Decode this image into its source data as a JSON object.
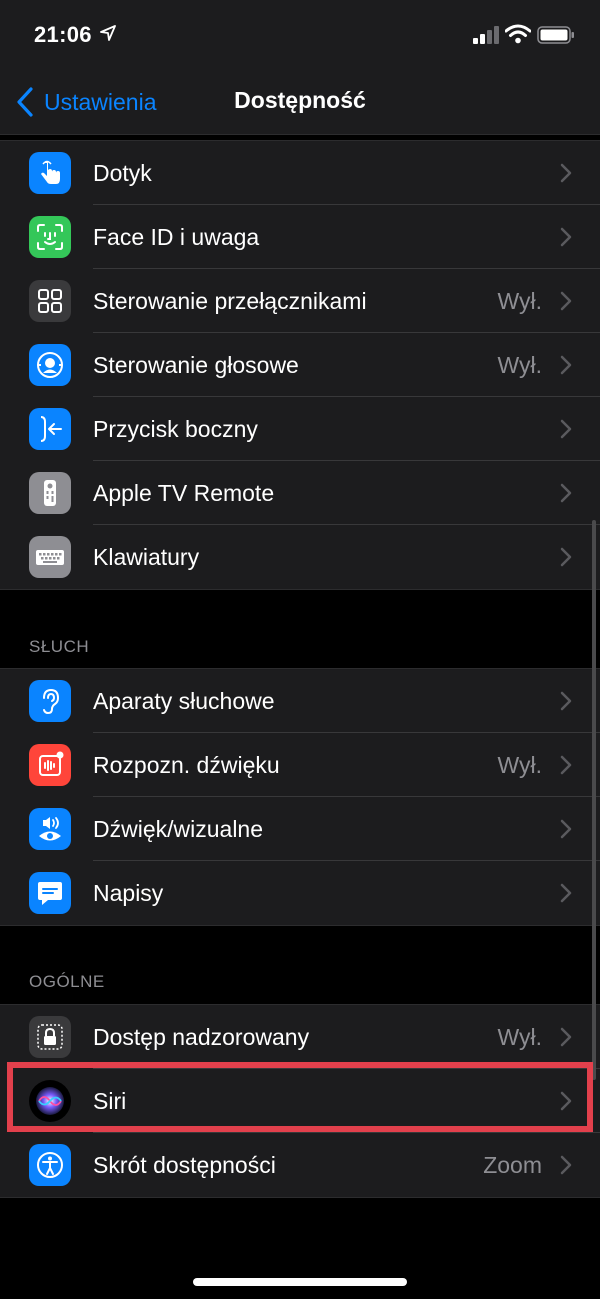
{
  "status_bar": {
    "time": "21:06"
  },
  "nav": {
    "back_label": "Ustawienia",
    "title": "Dostępność"
  },
  "groups": {
    "physical": {
      "items": [
        {
          "label": "Dotyk",
          "value": "",
          "icon": "hand-tap-icon",
          "color": "#0a84ff"
        },
        {
          "label": "Face ID i uwaga",
          "value": "",
          "icon": "face-id-icon",
          "color": "#34c759"
        },
        {
          "label": "Sterowanie przełącznikami",
          "value": "Wył.",
          "icon": "grid-icon",
          "color": "#3a3a3c"
        },
        {
          "label": "Sterowanie głosowe",
          "value": "Wył.",
          "icon": "voice-control-icon",
          "color": "#0a84ff"
        },
        {
          "label": "Przycisk boczny",
          "value": "",
          "icon": "side-button-icon",
          "color": "#0a84ff"
        },
        {
          "label": "Apple TV Remote",
          "value": "",
          "icon": "tv-remote-icon",
          "color": "#8e8e93"
        },
        {
          "label": "Klawiatury",
          "value": "",
          "icon": "keyboard-icon",
          "color": "#8e8e93"
        }
      ]
    },
    "hearing": {
      "header": "SŁUCH",
      "items": [
        {
          "label": "Aparaty słuchowe",
          "value": "",
          "icon": "ear-icon",
          "color": "#0a84ff"
        },
        {
          "label": "Rozpozn. dźwięku",
          "value": "Wył.",
          "icon": "sound-recognition-icon",
          "color": "#ff453a"
        },
        {
          "label": "Dźwięk/wizualne",
          "value": "",
          "icon": "audio-visual-icon",
          "color": "#0a84ff"
        },
        {
          "label": "Napisy",
          "value": "",
          "icon": "subtitles-icon",
          "color": "#0a84ff"
        }
      ]
    },
    "general": {
      "header": "OGÓLNE",
      "items": [
        {
          "label": "Dostęp nadzorowany",
          "value": "Wył.",
          "icon": "guided-access-lock-icon",
          "color": "#3a3a3c"
        },
        {
          "label": "Siri",
          "value": "",
          "icon": "siri-icon",
          "color": "#000000"
        },
        {
          "label": "Skrót dostępności",
          "value": "Zoom",
          "icon": "accessibility-icon",
          "color": "#0a84ff"
        }
      ]
    }
  },
  "colors": {
    "accent": "#0a84ff",
    "highlight": "#e2404c",
    "group_bg": "#1c1c1e",
    "background": "#000000",
    "secondary_text": "#8e8e93"
  }
}
